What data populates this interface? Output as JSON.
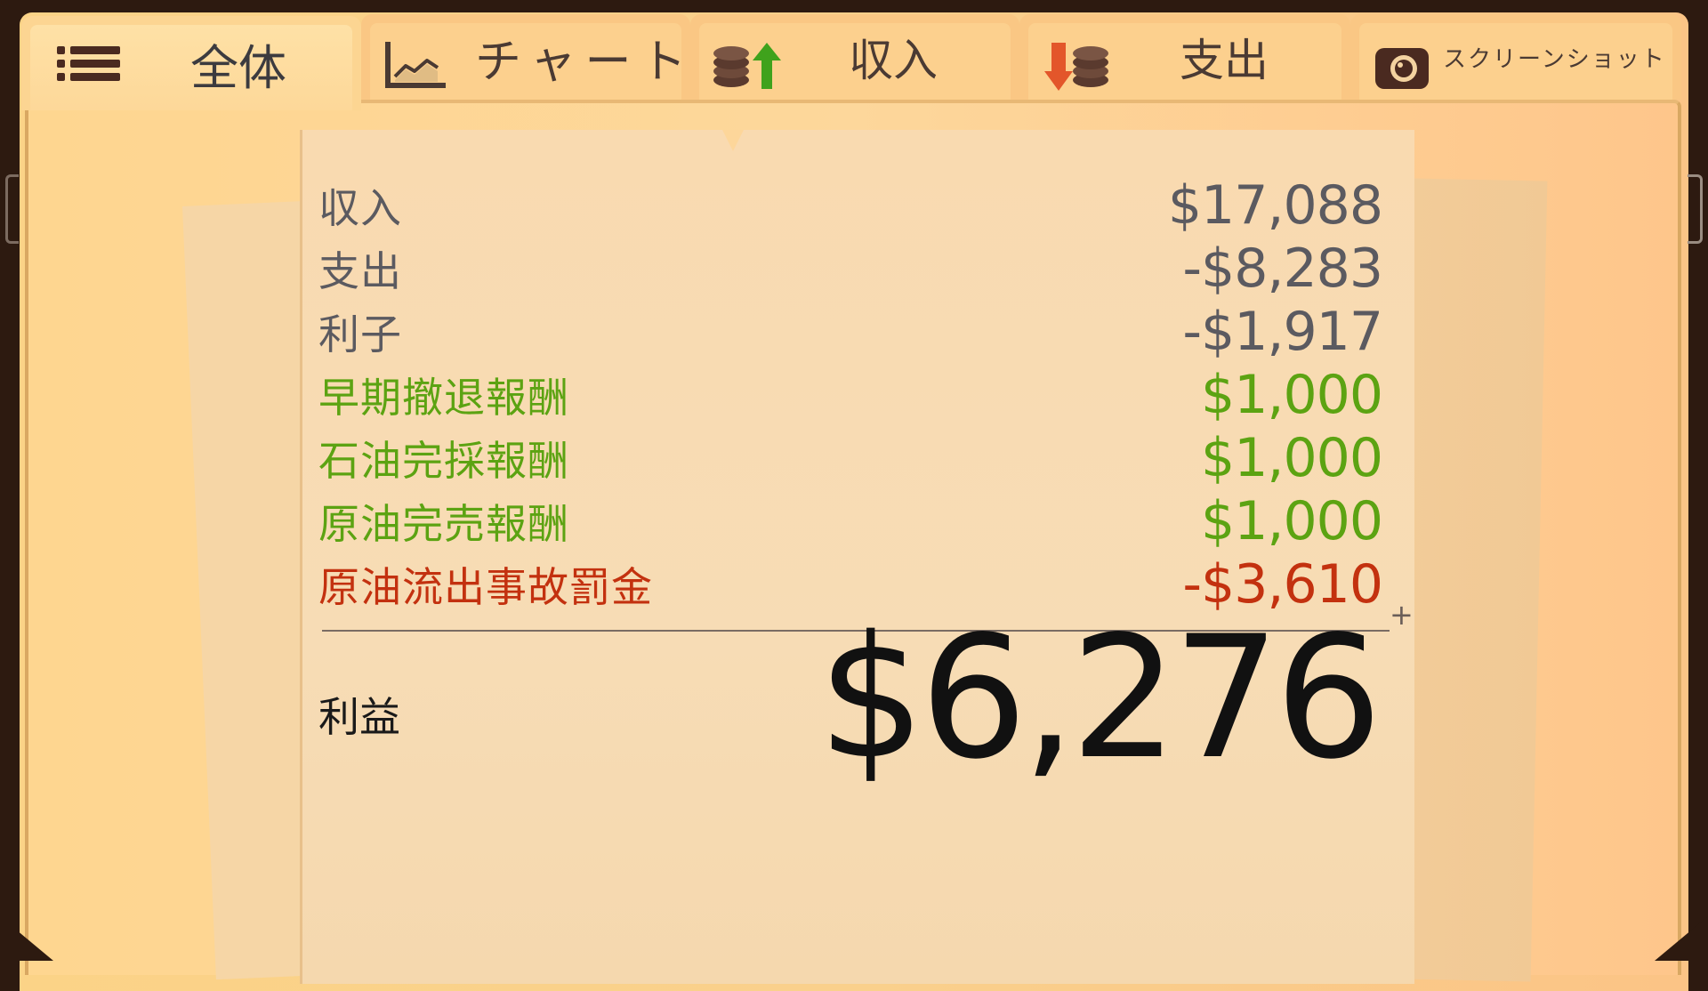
{
  "tabs": [
    {
      "label": "全体",
      "icon": "list-icon",
      "active": true
    },
    {
      "label": "チャート",
      "icon": "line-chart-icon",
      "active": false
    },
    {
      "label": "収入",
      "icon": "coins-up-icon",
      "active": false
    },
    {
      "label": "支出",
      "icon": "coins-down-icon",
      "active": false
    },
    {
      "label": "スクリーンショット",
      "icon": "camera-icon",
      "active": false
    }
  ],
  "ledger": {
    "rows": [
      {
        "label": "収入",
        "value": "$17,088",
        "color": "#5b5a60"
      },
      {
        "label": "支出",
        "value": "-$8,283",
        "color": "#5b5a60"
      },
      {
        "label": "利子",
        "value": "-$1,917",
        "color": "#5b5a60"
      },
      {
        "label": "早期撤退報酬",
        "value": "$1,000",
        "color": "#5ca312"
      },
      {
        "label": "石油完採報酬",
        "value": "$1,000",
        "color": "#5ca312"
      },
      {
        "label": "原油完売報酬",
        "value": "$1,000",
        "color": "#5ca312"
      },
      {
        "label": "原油流出事故罰金",
        "value": "-$3,610",
        "color": "#c3310f"
      }
    ],
    "sum_mark": "+",
    "profit_label": "利益",
    "profit_value": "$6,276"
  },
  "colors": {
    "frame": "#fbd387",
    "paper": "#f7dcb5",
    "neutral_text": "#5b5a60",
    "bonus_text": "#5ca312",
    "penalty_text": "#c3310f"
  }
}
